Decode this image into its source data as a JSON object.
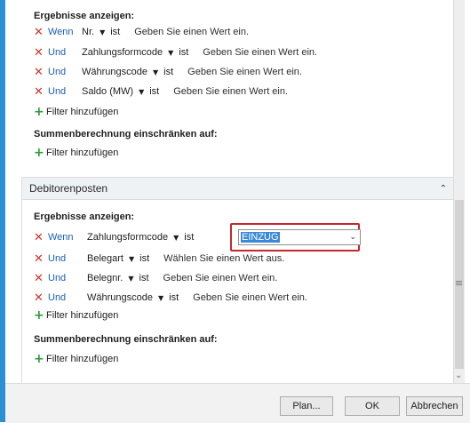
{
  "top": {
    "results_title": "Ergebnisse anzeigen:",
    "rows": [
      {
        "kw": "Wenn",
        "field": "Nr.",
        "op": "ist",
        "value": "Geben Sie einen Wert ein."
      },
      {
        "kw": "Und",
        "field": "Zahlungsformcode",
        "op": "ist",
        "value": "Geben Sie einen Wert ein."
      },
      {
        "kw": "Und",
        "field": "Währungscode",
        "op": "ist",
        "value": "Geben Sie einen Wert ein."
      },
      {
        "kw": "Und",
        "field": "Saldo (MW)",
        "op": "ist",
        "value": "Geben Sie einen Wert ein."
      }
    ],
    "add_filter": "Filter hinzufügen",
    "sum_title": "Summenberechnung einschränken auf:",
    "sum_add_filter": "Filter hinzufügen"
  },
  "panel": {
    "title": "Debitorenposten",
    "results_title": "Ergebnisse anzeigen:",
    "rows": [
      {
        "kw": "Wenn",
        "field": "Zahlungsformcode",
        "op": "ist",
        "value": "EINZUG"
      },
      {
        "kw": "Und",
        "field": "Belegart",
        "op": "ist",
        "value": "Wählen Sie einen Wert aus."
      },
      {
        "kw": "Und",
        "field": "Belegnr.",
        "op": "ist",
        "value": "Geben Sie einen Wert ein."
      },
      {
        "kw": "Und",
        "field": "Währungscode",
        "op": "ist",
        "value": "Geben Sie einen Wert ein."
      }
    ],
    "add_filter": "Filter hinzufügen",
    "sum_title": "Summenberechnung einschränken auf:",
    "sum_add_filter": "Filter hinzufügen"
  },
  "buttons": {
    "plan": "Plan...",
    "ok": "OK",
    "cancel": "Abbrechen"
  },
  "icons": {
    "remove": "x-icon",
    "add": "plus-icon",
    "dropdown": "triangle-down-icon",
    "collapse": "chevron-up-icon"
  },
  "colors": {
    "accent": "#2b8fd6",
    "remove": "#d0342c",
    "add": "#2e9b3a",
    "link": "#1a5fb4",
    "highlight": "#c6262e"
  }
}
